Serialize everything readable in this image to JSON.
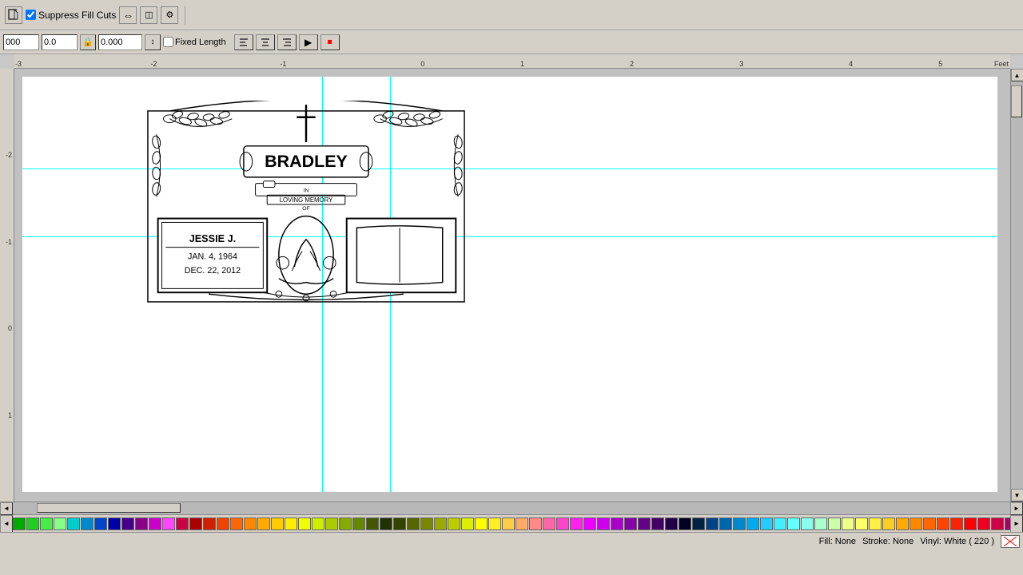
{
  "toolbar_top": {
    "suppress_fill_label": "Suppress Fill Cuts",
    "icons": [
      "file-icon",
      "arrow-icon",
      "mirror-icon",
      "settings-icon"
    ],
    "separator": true
  },
  "toolbar_second": {
    "input1": {
      "value": "000",
      "width": 45
    },
    "input2": {
      "value": "0.0",
      "width": 45
    },
    "input3_value": "0.000",
    "fixed_length_label": "Fixed Length",
    "align_icons": [
      "align-left",
      "align-center",
      "align-right"
    ],
    "extra_btn1": "play-icon",
    "extra_btn2": "stop-icon"
  },
  "ruler": {
    "top_label": "Feet",
    "marks": [
      "-3",
      "-2",
      "-1",
      "0",
      "1",
      "2",
      "3",
      "4",
      "5"
    ],
    "v_marks": [
      "-2",
      "",
      "",
      "",
      "",
      ""
    ]
  },
  "artwork": {
    "title": "BRADLEY",
    "subtitle": "IN LOVING MEMORY OF",
    "name_text": "JESSIE J.",
    "date1": "JAN. 4, 1964",
    "date2": "DEC. 22, 2012"
  },
  "status": {
    "fill_label": "Fill: None",
    "stroke_label": "Stroke: None",
    "vinyl_label": "Vinyl: White ( 220 )"
  },
  "colors": [
    "#00aa00",
    "#22cc22",
    "#44ee44",
    "#88ff88",
    "#00cccc",
    "#0088cc",
    "#0044cc",
    "#0000aa",
    "#440088",
    "#880088",
    "#cc00cc",
    "#ff44ff",
    "#cc0044",
    "#aa0000",
    "#cc2200",
    "#ee4400",
    "#ff6600",
    "#ff8800",
    "#ffaa00",
    "#ffcc00",
    "#ffee00",
    "#eeff00",
    "#ccee00",
    "#aacc00",
    "#88aa00",
    "#668800",
    "#445500",
    "#223300",
    "#334400",
    "#556600",
    "#778800",
    "#99aa00",
    "#bbcc00",
    "#ddee00",
    "#ffff00",
    "#ffee22",
    "#ffcc44",
    "#ffaa66",
    "#ff8888",
    "#ff66aa",
    "#ff44cc",
    "#ff22ee",
    "#ee00ff",
    "#cc00ee",
    "#aa00cc",
    "#8800aa",
    "#660088",
    "#440066",
    "#220044",
    "#000022",
    "#002244",
    "#004488",
    "#0066aa",
    "#0088cc",
    "#00aaee",
    "#22ccff",
    "#44eeff",
    "#66ffff",
    "#88ffee",
    "#aaffcc",
    "#ccffaa",
    "#eeff88",
    "#ffff66",
    "#ffee44",
    "#ffcc22",
    "#ffaa00",
    "#ff8800",
    "#ff6600",
    "#ff4400",
    "#ff2200",
    "#ff0000",
    "#ee0022",
    "#cc0044",
    "#aa0066",
    "#880088",
    "#6600aa",
    "#4400cc",
    "#2200ee",
    "#0000ff",
    "#2222ff"
  ]
}
